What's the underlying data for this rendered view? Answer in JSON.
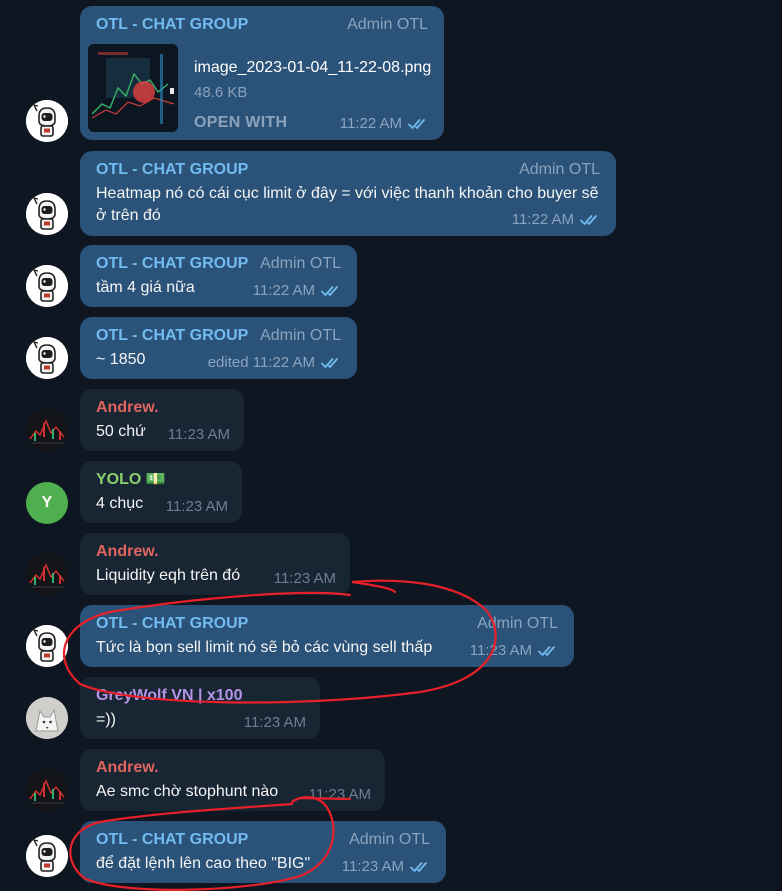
{
  "group_name": "OTL - CHAT GROUP",
  "admin_role": "Admin OTL",
  "messages": [
    {
      "type": "file",
      "sender": "OTL - CHAT GROUP",
      "role": "Admin OTL",
      "file_name": "image_2023-01-04_11-22-08.png",
      "file_size": "48.6 KB",
      "open_label": "OPEN WITH",
      "time": "11:22 AM"
    },
    {
      "sender": "OTL - CHAT GROUP",
      "role": "Admin OTL",
      "text": "Heatmap nó có cái cục limit ở đây = với việc thanh khoản cho buyer sẽ ở trên đó",
      "time": "11:22 AM"
    },
    {
      "sender": "OTL - CHAT GROUP",
      "role": "Admin OTL",
      "text": "tầm 4 giá nữa",
      "time": "11:22 AM"
    },
    {
      "sender": "OTL - CHAT GROUP",
      "role": "Admin OTL",
      "text": "~ 1850",
      "time": "edited 11:22 AM"
    },
    {
      "sender": "Andrew.",
      "text": "50 chứ",
      "time": "11:23 AM"
    },
    {
      "sender": "YOLO 💵",
      "avatar_letter": "Y",
      "text": "4 chục",
      "time": "11:23 AM"
    },
    {
      "sender": "Andrew.",
      "text": "Liquidity eqh trên đó",
      "time": "11:23 AM"
    },
    {
      "sender": "OTL - CHAT GROUP",
      "role": "Admin OTL",
      "text": "Tức là bọn sell limit nó sẽ bỏ các vùng sell thấp",
      "time": "11:23 AM"
    },
    {
      "sender": "GreyWolf VN | x100",
      "text": "=))",
      "time": "11:23 AM"
    },
    {
      "sender": "Andrew.",
      "text": "Ae smc chờ stophunt nào",
      "time": "11:23 AM"
    },
    {
      "sender": "OTL - CHAT GROUP",
      "role": "Admin OTL",
      "text": "để đặt lệnh lên cao theo \"BIG\"",
      "time": "11:23 AM"
    }
  ],
  "icons": {
    "read_receipt": "double-check-icon",
    "otl_avatar": "astronaut-avatar-icon",
    "andrew_avatar": "chart-avatar-icon",
    "grey_avatar": "wolf-avatar-icon"
  },
  "colors": {
    "background": "#0e1621",
    "bubble_incoming": "#182533",
    "bubble_outgoing": "#2b5278",
    "otl_name": "#71bbf0",
    "andrew_name": "#e0655e",
    "yolo_name": "#8ad16d",
    "grey_name": "#b594e8",
    "annotation": "#e8202a"
  }
}
